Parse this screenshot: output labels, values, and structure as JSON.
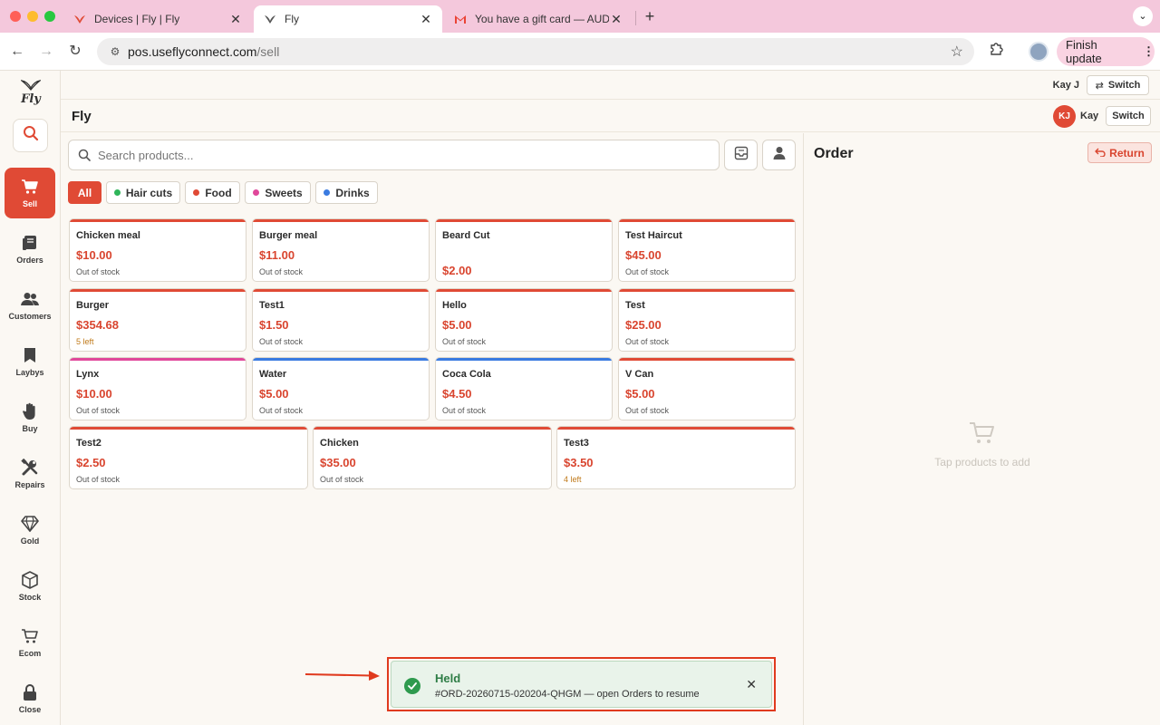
{
  "browser": {
    "tabs": [
      {
        "title": "Devices | Fly | Fly",
        "icon": "fly-icon",
        "active": false
      },
      {
        "title": "Fly",
        "icon": "fly-icon",
        "active": true
      },
      {
        "title": "You have a gift card — AUD $",
        "icon": "gmail-icon",
        "active": false
      }
    ],
    "url_host": "pos.useflyconnect.com",
    "url_path": "/sell",
    "finish_update_label": "Finish update",
    "traffic_colors": [
      "#ff5f57",
      "#febc2e",
      "#28c840"
    ]
  },
  "app": {
    "logo_text": "Fly",
    "store_title": "Fly",
    "user_top": "Kay J",
    "switch_label": "Switch",
    "avatar_initials": "KJ",
    "user_name": "Kay",
    "accent_color": "#e04a35"
  },
  "sidebar": {
    "items": [
      {
        "label": "Sell",
        "icon": "cart-icon",
        "active": true
      },
      {
        "label": "Orders",
        "icon": "orders-icon"
      },
      {
        "label": "Customers",
        "icon": "customers-icon"
      },
      {
        "label": "Laybys",
        "icon": "bookmark-icon"
      },
      {
        "label": "Buy",
        "icon": "hand-icon"
      },
      {
        "label": "Repairs",
        "icon": "tools-icon"
      },
      {
        "label": "Gold",
        "icon": "diamond-icon"
      },
      {
        "label": "Stock",
        "icon": "box-icon"
      },
      {
        "label": "Ecom",
        "icon": "cart-outline-icon"
      },
      {
        "label": "Close",
        "icon": "lock-icon"
      }
    ]
  },
  "search": {
    "placeholder": "Search products..."
  },
  "categories": [
    {
      "label": "All",
      "active": true
    },
    {
      "label": "Hair cuts",
      "color": "#2fb55a"
    },
    {
      "label": "Food",
      "color": "#e04a35"
    },
    {
      "label": "Sweets",
      "color": "#e0479a"
    },
    {
      "label": "Drinks",
      "color": "#3a7be0"
    }
  ],
  "products": [
    {
      "name": "Chicken meal",
      "price": "$10.00",
      "stock": "Out of stock",
      "color": "#e04a35"
    },
    {
      "name": "Burger meal",
      "price": "$11.00",
      "stock": "Out of stock",
      "color": "#e04a35"
    },
    {
      "name": "Beard Cut",
      "price": "$2.00",
      "stock": "",
      "color": "#e04a35"
    },
    {
      "name": "Test Haircut",
      "price": "$45.00",
      "stock": "Out of stock",
      "color": "#e04a35"
    },
    {
      "name": "Burger",
      "price": "$354.68",
      "stock": "5 left",
      "color": "#e04a35"
    },
    {
      "name": "Test1",
      "price": "$1.50",
      "stock": "Out of stock",
      "color": "#e04a35"
    },
    {
      "name": "Hello",
      "price": "$5.00",
      "stock": "Out of stock",
      "color": "#e04a35"
    },
    {
      "name": "Test",
      "price": "$25.00",
      "stock": "Out of stock",
      "color": "#e04a35"
    },
    {
      "name": "Lynx",
      "price": "$10.00",
      "stock": "Out of stock",
      "color": "#e0479a"
    },
    {
      "name": "Water",
      "price": "$5.00",
      "stock": "Out of stock",
      "color": "#3a7be0"
    },
    {
      "name": "Coca Cola",
      "price": "$4.50",
      "stock": "Out of stock",
      "color": "#3a7be0"
    },
    {
      "name": "V Can",
      "price": "$5.00",
      "stock": "Out of stock",
      "color": "#e04a35"
    },
    {
      "name": "Test2",
      "price": "$2.50",
      "stock": "Out of stock",
      "color": "#e04a35"
    },
    {
      "name": "Chicken",
      "price": "$35.00",
      "stock": "Out of stock",
      "color": "#e04a35"
    },
    {
      "name": "Test3",
      "price": "$3.50",
      "stock": "4 left",
      "color": "#e04a35"
    }
  ],
  "order": {
    "title": "Order",
    "return_label": "Return",
    "empty_text": "Tap products to add"
  },
  "toast": {
    "title": "Held",
    "message": "#ORD-20260715-020204-QHGM — open Orders to resume"
  }
}
